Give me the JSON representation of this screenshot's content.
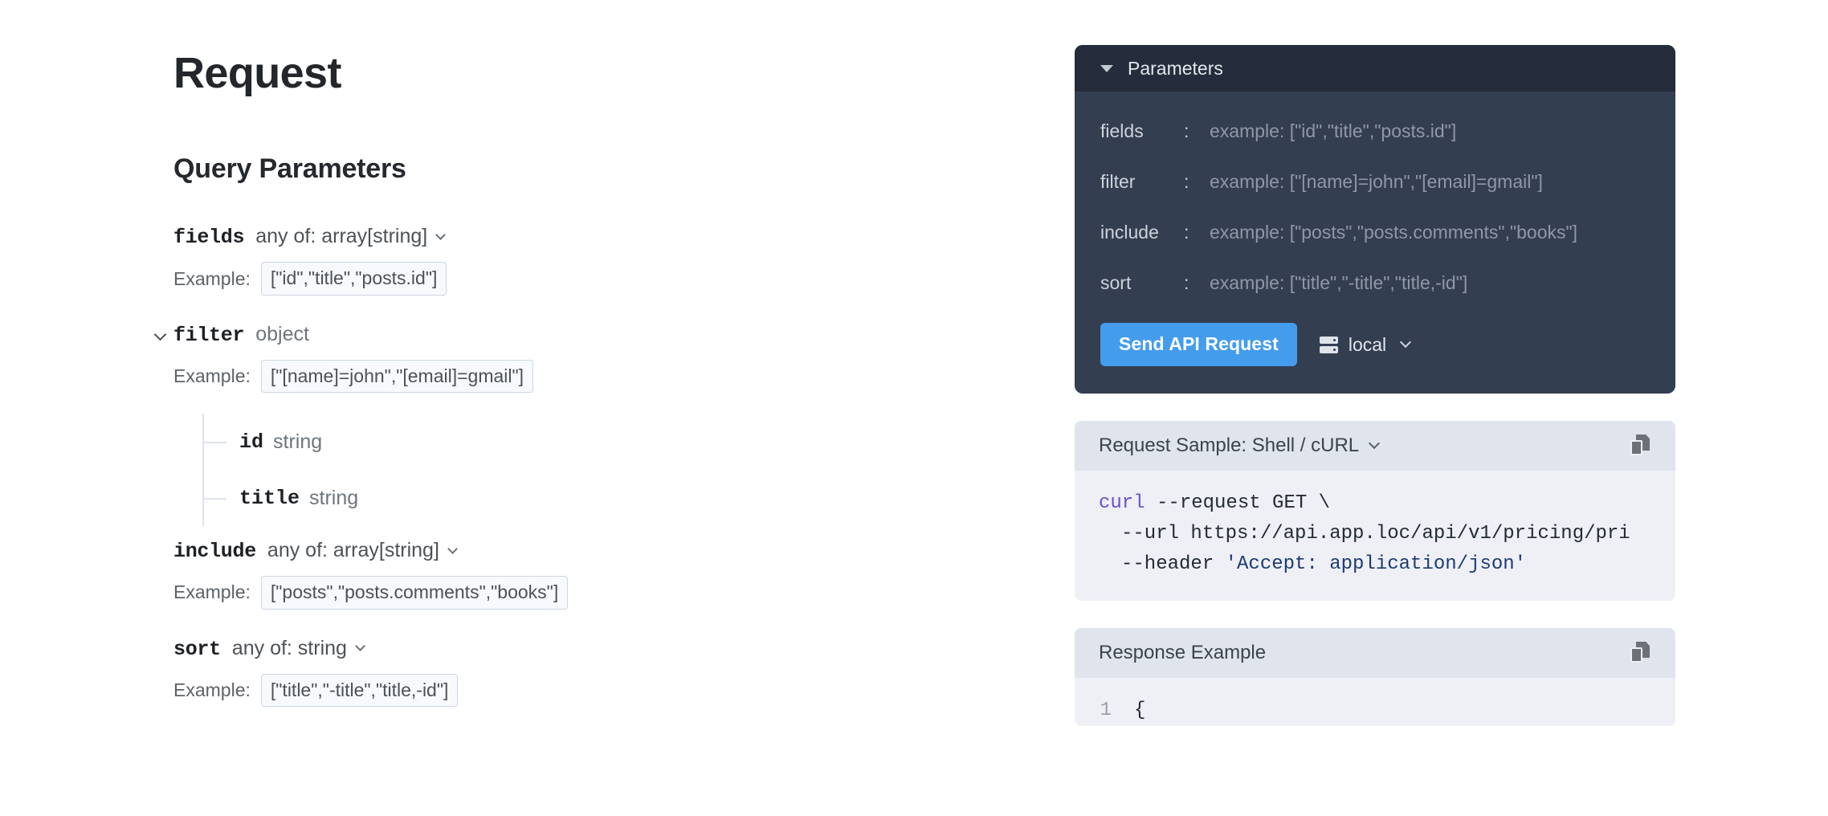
{
  "doc": {
    "page_title": "Request",
    "section_title": "Query Parameters",
    "params": [
      {
        "name": "fields",
        "type": "any of: array[string]",
        "has_caret": false,
        "has_type_chevron": true,
        "example_label": "Example:",
        "example_value": "[\"id\",\"title\",\"posts.id\"]",
        "children": []
      },
      {
        "name": "filter",
        "type": "object",
        "has_caret": true,
        "has_type_chevron": false,
        "example_label": "Example:",
        "example_value": "[\"[name]=john\",\"[email]=gmail\"]",
        "children": [
          {
            "name": "id",
            "type": "string"
          },
          {
            "name": "title",
            "type": "string"
          }
        ]
      },
      {
        "name": "include",
        "type": "any of: array[string]",
        "has_caret": false,
        "has_type_chevron": true,
        "example_label": "Example:",
        "example_value": "[\"posts\",\"posts.comments\",\"books\"]",
        "children": []
      },
      {
        "name": "sort",
        "type": "any of: string",
        "has_caret": false,
        "has_type_chevron": true,
        "example_label": "Example:",
        "example_value": "[\"title\",\"-title\",\"title,-id\"]",
        "children": []
      }
    ]
  },
  "parameters_panel": {
    "title": "Parameters",
    "rows": [
      {
        "key": "fields",
        "colon": ":",
        "value": "example: [\"id\",\"title\",\"posts.id\"]"
      },
      {
        "key": "filter",
        "colon": ":",
        "value": "example: [\"[name]=john\",\"[email]=gmail\"]"
      },
      {
        "key": "include",
        "colon": ":",
        "value": "example: [\"posts\",\"posts.comments\",\"books\"]"
      },
      {
        "key": "sort",
        "colon": ":",
        "value": "example: [\"title\",\"-title\",\"title,-id\"]"
      }
    ],
    "send_button": "Send API Request",
    "environment": "local",
    "accent_color": "#449cec",
    "header_bg": "#252c3b",
    "body_bg": "#333e51"
  },
  "request_sample": {
    "title": "Request Sample: Shell / cURL",
    "code": {
      "line1_cmd": "curl",
      "line1_rest": " --request GET \\",
      "line2": "--url https://api.app.loc/api/v1/pricing/pri",
      "line3_flag": "--header ",
      "line3_str": "'Accept: application/json'"
    }
  },
  "response_example": {
    "title": "Response Example",
    "line_number": "1",
    "line_text": "{"
  }
}
